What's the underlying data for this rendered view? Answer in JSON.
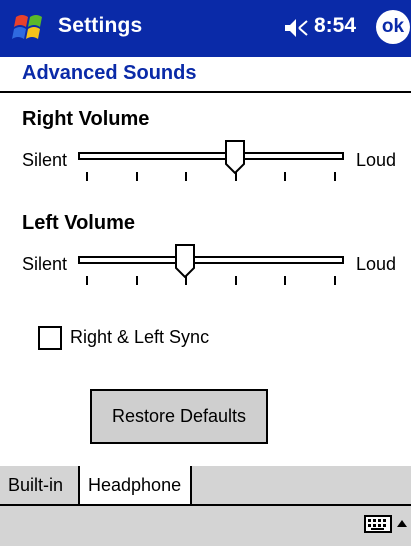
{
  "titlebar": {
    "title": "Settings",
    "time": "8:54",
    "ok_label": "ok",
    "accent": "#0a2aa8"
  },
  "subtitle": "Advanced Sounds",
  "right_volume": {
    "label": "Right Volume",
    "min_label": "Silent",
    "max_label": "Loud",
    "level": 0.6
  },
  "left_volume": {
    "label": "Left Volume",
    "min_label": "Silent",
    "max_label": "Loud",
    "level": 0.4
  },
  "sync": {
    "label": "Right &  Left Sync",
    "checked": false
  },
  "restore_button": "Restore Defaults",
  "tabs": [
    {
      "label": "Built-in",
      "active": false
    },
    {
      "label": "Headphone",
      "active": true
    }
  ]
}
